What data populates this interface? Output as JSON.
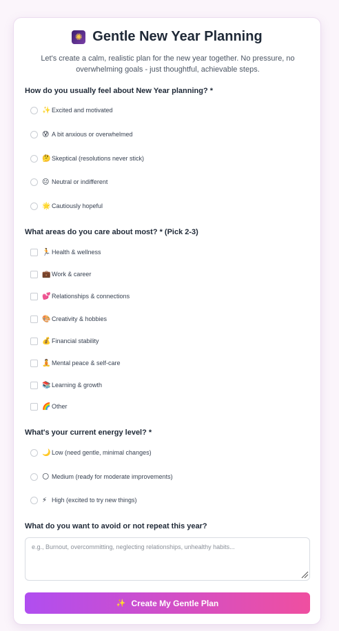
{
  "header": {
    "icon": "sparkler-icon",
    "title": "Gentle New Year Planning",
    "subtitle": "Let's create a calm, realistic plan for the new year together. No pressure, no overwhelming goals - just thoughtful, achievable steps."
  },
  "q1": {
    "label": "How do you usually feel about New Year planning? *",
    "options": [
      {
        "emoji": "✨",
        "text": "Excited and motivated"
      },
      {
        "emoji": "😰",
        "text": "A bit anxious or overwhelmed"
      },
      {
        "emoji": "🤔",
        "text": "Skeptical (resolutions never stick)"
      },
      {
        "emoji": "😐",
        "text": "Neutral or indifferent"
      },
      {
        "emoji": "🌟",
        "text": "Cautiously hopeful"
      }
    ]
  },
  "q2": {
    "label": "What areas do you care about most? * (Pick 2-3)",
    "options": [
      {
        "emoji": "🏃",
        "text": "Health & wellness"
      },
      {
        "emoji": "💼",
        "text": "Work & career"
      },
      {
        "emoji": "💕",
        "text": "Relationships & connections"
      },
      {
        "emoji": "🎨",
        "text": "Creativity & hobbies"
      },
      {
        "emoji": "💰",
        "text": "Financial stability"
      },
      {
        "emoji": "🧘",
        "text": "Mental peace & self-care"
      },
      {
        "emoji": "📚",
        "text": "Learning & growth"
      },
      {
        "emoji": "🌈",
        "text": "Other"
      }
    ]
  },
  "q3": {
    "label": "What's your current energy level? *",
    "options": [
      {
        "emoji": "🌙",
        "text": "Low (need gentle, minimal changes)"
      },
      {
        "emoji": "🌕",
        "text": "Medium (ready for moderate improvements)"
      },
      {
        "emoji": "⚡",
        "text": "High (excited to try new things)"
      }
    ]
  },
  "q4": {
    "label": "What do you want to avoid or not repeat this year?",
    "placeholder": "e.g., Burnout, overcommitting, neglecting relationships, unhealthy habits...",
    "value": ""
  },
  "submit": {
    "icon": "sparkles-icon",
    "label": "Create My Gentle Plan"
  }
}
